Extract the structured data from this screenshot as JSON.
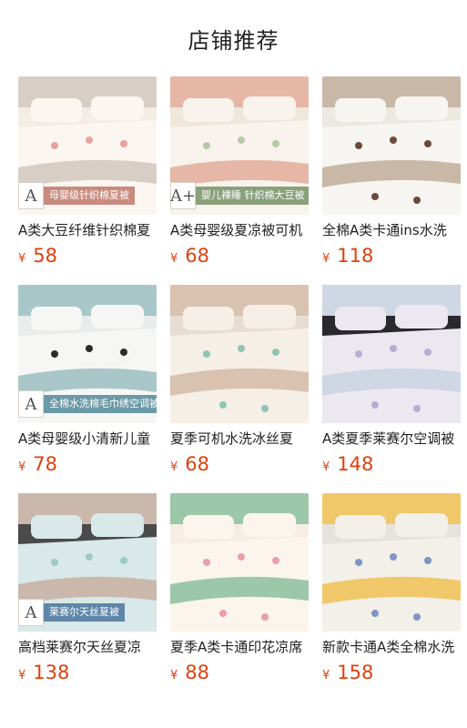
{
  "page": {
    "title": "店铺推荐"
  },
  "products": [
    {
      "name": "A类大豆纤维针织棉夏",
      "currency": "¥",
      "price": "58",
      "badge": "母婴级针织棉夏被",
      "badge_mark": "A",
      "badge_color": "#c98b7e",
      "palette": [
        "#f3ede6",
        "#fbf6f1",
        "#e8a39a",
        "#d7cfc6"
      ]
    },
    {
      "name": "A类母婴级夏凉被可机",
      "currency": "¥",
      "price": "68",
      "badge": "婴儿裸睡 针织棉大豆被",
      "badge_mark": "A+",
      "badge_color": "#8aa07a",
      "palette": [
        "#efe7dc",
        "#f8f3ec",
        "#b7c9a8",
        "#e6b7a6"
      ]
    },
    {
      "name": "全棉A类卡通ins水洗",
      "currency": "¥",
      "price": "118",
      "badge": "",
      "badge_mark": "",
      "badge_color": "",
      "palette": [
        "#ece8e2",
        "#f7f5f1",
        "#6b4a3a",
        "#c9b8a6"
      ]
    },
    {
      "name": "A类母婴级小清新儿童",
      "currency": "¥",
      "price": "78",
      "badge": "全棉水洗棉毛巾绣空调被",
      "badge_mark": "A",
      "badge_color": "#6a9aa8",
      "palette": [
        "#e9ecea",
        "#f6f7f5",
        "#2b2b2b",
        "#a9c7c9"
      ]
    },
    {
      "name": "夏季可机水洗冰丝夏",
      "currency": "¥",
      "price": "68",
      "badge": "",
      "badge_mark": "",
      "badge_color": "",
      "palette": [
        "#e7ddd3",
        "#f5efe8",
        "#8fc4b3",
        "#d9c2b0"
      ]
    },
    {
      "name": "A类夏季莱赛尔空调被",
      "currency": "¥",
      "price": "148",
      "badge": "",
      "badge_mark": "",
      "badge_color": "",
      "palette": [
        "#2a2a2e",
        "#ece8f0",
        "#b9acd2",
        "#cfd7e4"
      ]
    },
    {
      "name": "高档莱赛尔天丝夏凉",
      "currency": "¥",
      "price": "138",
      "badge": "莱赛尔天丝夏被",
      "badge_mark": "A",
      "badge_color": "#5e86a8",
      "palette": [
        "#4a4a4a",
        "#d9e8e8",
        "#9ec9c9",
        "#c9b8ab"
      ]
    },
    {
      "name": "夏季A类卡通印花凉席",
      "currency": "¥",
      "price": "88",
      "badge": "",
      "badge_mark": "",
      "badge_color": "",
      "palette": [
        "#f6eee6",
        "#fbf5ee",
        "#e9a0a6",
        "#9cc7a8"
      ]
    },
    {
      "name": "新款卡通A类全棉水洗",
      "currency": "¥",
      "price": "158",
      "badge": "",
      "badge_mark": "",
      "badge_color": "",
      "palette": [
        "#e6e2dc",
        "#f3efe9",
        "#7f95c4",
        "#f0c86a"
      ]
    }
  ]
}
